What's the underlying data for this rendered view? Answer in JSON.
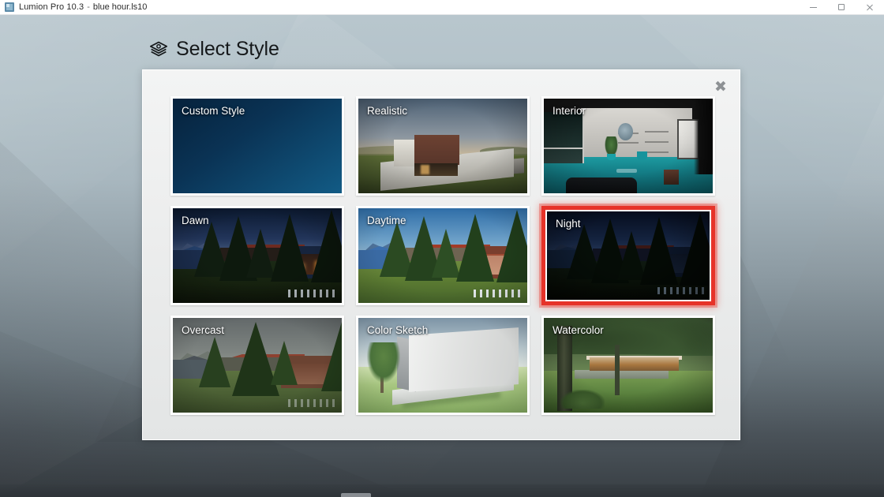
{
  "window": {
    "app_title": "Lumion Pro 10.3",
    "separator": "-",
    "file_name": "blue hour.ls10",
    "controls": {
      "minimize": "minimize-button",
      "restore": "restore-button",
      "close": "close-button"
    }
  },
  "header": {
    "title": "Select Style",
    "icon": "layers-icon"
  },
  "dialog": {
    "close_label": "✖",
    "styles": [
      {
        "label": "Custom Style",
        "art": "custom",
        "selected": false
      },
      {
        "label": "Realistic",
        "art": "realistic",
        "selected": false
      },
      {
        "label": "Interior",
        "art": "interior",
        "selected": false
      },
      {
        "label": "Dawn",
        "art": "dawn",
        "selected": false
      },
      {
        "label": "Daytime",
        "art": "daytime",
        "selected": false
      },
      {
        "label": "Night",
        "art": "night",
        "selected": true
      },
      {
        "label": "Overcast",
        "art": "overcast",
        "selected": false
      },
      {
        "label": "Color Sketch",
        "art": "sketch",
        "selected": false
      },
      {
        "label": "Watercolor",
        "art": "water",
        "selected": false
      }
    ]
  },
  "colors": {
    "selection_border": "#e63329",
    "custom_style_fill": "#0a3355",
    "dialog_background": "#eceded",
    "titlebar_background": "#ffffff",
    "desktop_top": "#b9c7ce",
    "desktop_bottom": "#383e43"
  }
}
